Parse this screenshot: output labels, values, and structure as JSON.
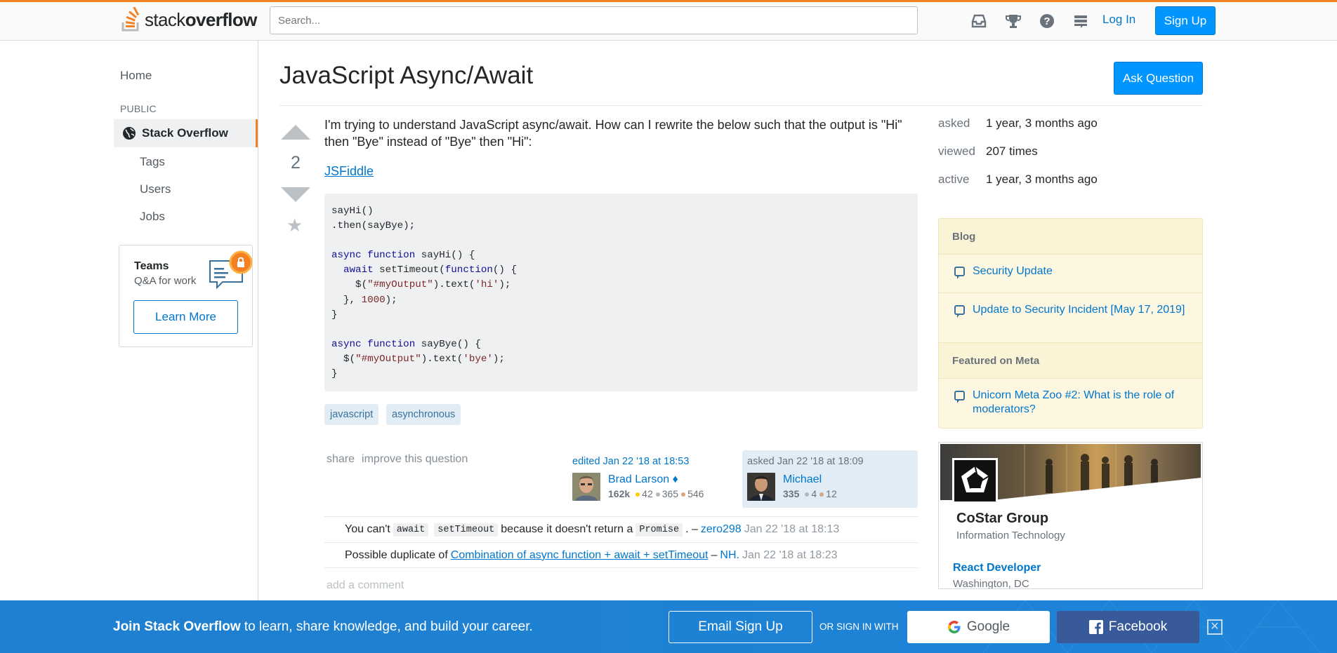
{
  "header": {
    "logo_text_plain": "stack",
    "logo_text_bold": "overflow",
    "search_placeholder": "Search...",
    "login_label": "Log In",
    "signup_label": "Sign Up"
  },
  "sidebar": {
    "home": "Home",
    "public_label": "PUBLIC",
    "stackoverflow": "Stack Overflow",
    "tags": "Tags",
    "users": "Users",
    "jobs": "Jobs",
    "teams_title": "Teams",
    "teams_sub": "Q&A for work",
    "learn_more": "Learn More"
  },
  "question": {
    "title": "JavaScript Async/Await",
    "ask_button": "Ask Question",
    "votes": "2",
    "body": "I'm trying to understand JavaScript async/await. How can I rewrite the below such that the output is \"Hi\" then \"Bye\" instead of \"Bye\" then \"Hi\":",
    "link": "JSFiddle",
    "tags": [
      "javascript",
      "asynchronous"
    ],
    "menu_share": "share",
    "menu_improve": "improve this question",
    "edited": {
      "action": "edited Jan 22 '18 at 18:53",
      "name": "Brad Larson ♦",
      "rep": "162k",
      "gold": "42",
      "silver": "365",
      "bronze": "546"
    },
    "asked": {
      "action": "asked Jan 22 '18 at 18:09",
      "name": "Michael",
      "rep": "335",
      "silver": "4",
      "bronze": "12"
    }
  },
  "comments": [
    {
      "pre": "You can't",
      "code1": "await",
      "code2": "setTimeout",
      "mid": "because it doesn't return a",
      "code3": "Promise",
      "post": ". –",
      "user": "zero298",
      "date": "Jan 22 '18 at 18:13"
    },
    {
      "pre": "Possible duplicate of",
      "link": "Combination of async function + await + setTimeout",
      "dash": "–",
      "user": "NH.",
      "date": "Jan 22 '18 at 18:23"
    }
  ],
  "add_comment": "add a comment",
  "meta": {
    "asked_k": "asked",
    "asked_v": "1 year, 3 months ago",
    "viewed_k": "viewed",
    "viewed_v": "207 times",
    "active_k": "active",
    "active_v": "1 year, 3 months ago"
  },
  "blog": {
    "blog_head": "Blog",
    "items": [
      "Security Update",
      "Update to Security Incident [May 17, 2019]"
    ],
    "meta_head": "Featured on Meta",
    "meta_items": [
      "Unicorn Meta Zoo #2: What is the role of moderators?"
    ]
  },
  "ad": {
    "company": "CoStar Group",
    "industry": "Information Technology",
    "job_title": "React Developer",
    "location": "Washington, DC"
  },
  "footer": {
    "text_bold": "Join Stack Overflow",
    "text_rest": " to learn, share knowledge, and build your career.",
    "email_btn": "Email Sign Up",
    "or_text": "OR SIGN IN WITH",
    "google_btn": "Google",
    "facebook_btn": "Facebook",
    "close": "✕"
  },
  "colors": {
    "accent_orange": "#f48024",
    "primary_blue": "#0095ff",
    "link_blue": "#0077cc",
    "footer_blue": "#1e84d8"
  }
}
